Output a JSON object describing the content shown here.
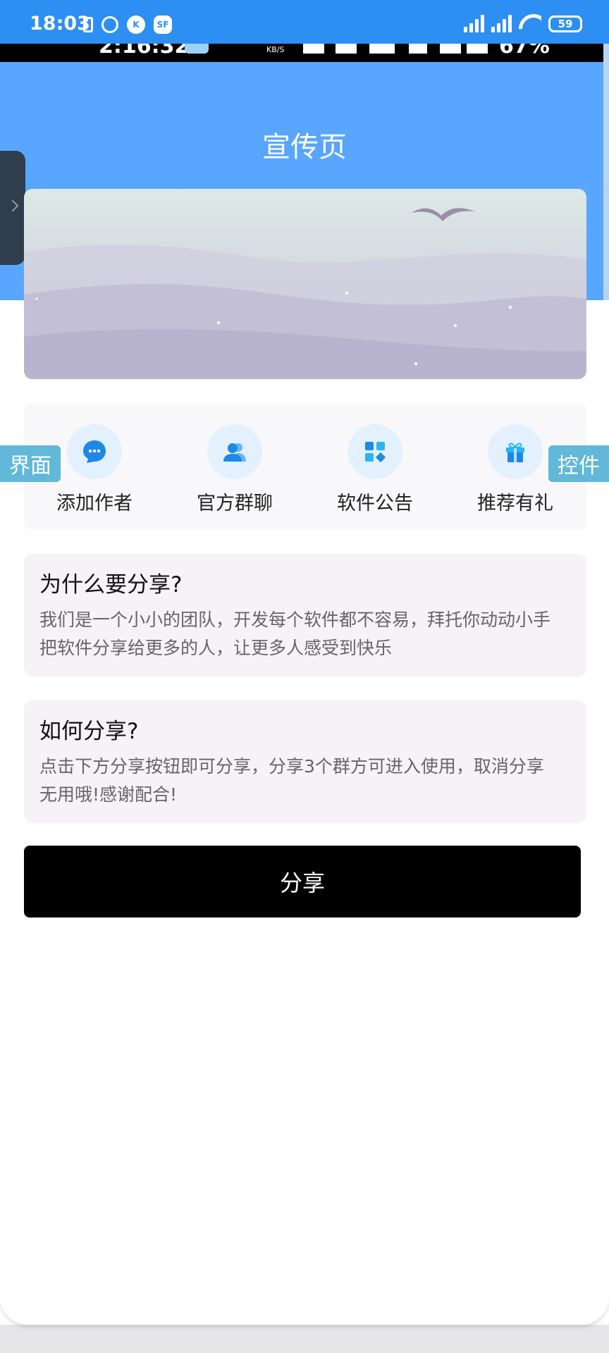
{
  "status_bar": {
    "time": "18:03",
    "badge_k": "K",
    "badge_sf": "SF",
    "battery": "59"
  },
  "inner_status": {
    "time": "2:16:32",
    "speed_unit": "KB/S",
    "battery_pct": "67%"
  },
  "header": {
    "title": "宣传页",
    "background_color": "#58a6fd"
  },
  "quick_actions": [
    {
      "label": "添加作者",
      "icon": "chat-bubble-icon"
    },
    {
      "label": "官方群聊",
      "icon": "group-people-icon"
    },
    {
      "label": "软件公告",
      "icon": "grid-apps-icon"
    },
    {
      "label": "推荐有礼",
      "icon": "gift-icon"
    }
  ],
  "floating_labels": {
    "left": "界面",
    "right": "控件"
  },
  "cards": [
    {
      "title": "为什么要分享?",
      "body_line1": "我们是一个小小的团队，开发每个软件都不容易，拜托你动动小手",
      "body_line2": "把软件分享给更多的人，让更多人感受到快乐"
    },
    {
      "title": "如何分享?",
      "body_line1": "点击下方分享按钮即可分享，分享3个群方可进入使用，取消分享",
      "body_line2": "无用哦!感谢配合!"
    }
  ],
  "share_button": {
    "label": "分享"
  },
  "colors": {
    "accent_blue": "#58a6fd",
    "icon_blue": "#1e88e5",
    "button_black": "#000000"
  }
}
